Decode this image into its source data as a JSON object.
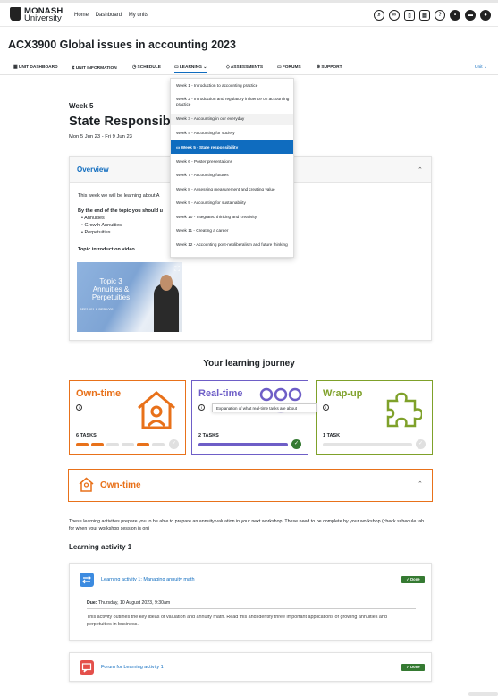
{
  "header": {
    "logo_line1": "MONASH",
    "logo_line2": "University",
    "nav": [
      "Home",
      "Dashboard",
      "My units"
    ]
  },
  "course_title": "ACX3900 Global issues in accounting 2023",
  "tabs": [
    {
      "label": "UNIT DASHBOARD",
      "icon": "grid-icon"
    },
    {
      "label": "UNIT INFORMATION",
      "icon": "hourglass-icon"
    },
    {
      "label": "SCHEDULE",
      "icon": "clock-icon"
    },
    {
      "label": "LEARNING",
      "icon": "book-icon"
    },
    {
      "label": "ASSESSMENTS",
      "icon": "assessment-icon"
    },
    {
      "label": "FORUMS",
      "icon": "chat-icon"
    },
    {
      "label": "SUPPORT",
      "icon": "support-icon"
    },
    {
      "label": "Unit",
      "icon": "chevron-down-icon"
    }
  ],
  "week": {
    "label": "Week 5",
    "title": "State Responsibili",
    "dates": "Mon 5 Jun 23 - Fri 9 Jun 23"
  },
  "overview": {
    "title": "Overview",
    "intro": "This week we will be learning about A",
    "objectives_heading": "By the end of the topic you should u",
    "items": [
      "Annuities",
      "Growth Annuities",
      "Perpetuities"
    ],
    "video_heading": "Topic introduction video",
    "video_title": "Topic 3 Annuities & Perpetuities",
    "video_sub": "BFF1001 & BFB1001"
  },
  "dropdown": [
    "Week 1 - Introduction to accounting practice",
    "Week 2 - Introduction and regulatory influence on accounting practice",
    "Week 3 - Accounting in our everyday",
    "Week 4 - Accounting for society",
    "Week 5 - State responsibility",
    "Week 6 - Poster presentations",
    "Week 7 - Accounting futures",
    "Week 8 - Assessing measurement and creating value",
    "Week 9 - Accounting for sustainability",
    "Week 10 - Integrated thinking and creativity",
    "Week 11 - Creating a career",
    "Week 12 - Accounting post-neoliberalism and future thinking"
  ],
  "journey": {
    "title": "Your learning journey",
    "tooltip": "Explanation of what real-time tasks are about",
    "own": {
      "title": "Own-time",
      "tasks": "6 TASKS",
      "progress": 0.43
    },
    "real": {
      "title": "Real-time",
      "tasks": "2 TASKS",
      "progress": 1
    },
    "wrap": {
      "title": "Wrap-up",
      "tasks": "1 TASK",
      "progress": 0
    }
  },
  "owntime": {
    "title": "Own-time",
    "desc": "These learning activities prepare you to be able to prepare an annuity valuation in your next workshop. These need to be complete by your workshop (check schedule tab for when your workshop session is on)",
    "section": "Learning activity 1"
  },
  "activities": [
    {
      "title": "Learning activity 1: Managing annuity math",
      "status": "Done",
      "due_label": "Due:",
      "due": "Thursday, 10 August 2023, 9:30am",
      "desc": "This activity outlines the key ideas of valuation and annuity math. Read this and identify three important applications of growing annuities and perpetuities in business."
    },
    {
      "title": "Forum for Learning activity 1",
      "status": "Done"
    }
  ],
  "colors": {
    "accent": "#0f6cbf",
    "own": "#e8711a",
    "real": "#6e5ec7",
    "wrap": "#7fa12a",
    "done": "#357a32"
  }
}
